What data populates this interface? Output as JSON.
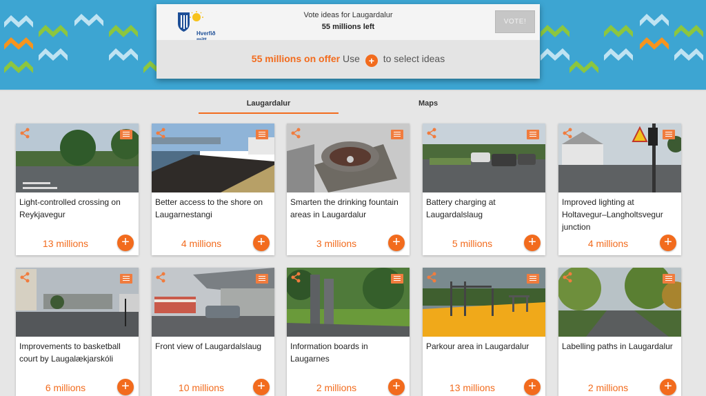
{
  "header": {
    "logo_text": "Hverfið mitt",
    "vote_title": "Vote ideas for Laugardalur",
    "millions_left": "55 millions left",
    "vote_button": "VOTE!",
    "offer_highlight": "55 millions on offer",
    "offer_use": "Use",
    "offer_plus": "+",
    "offer_select": "to select ideas"
  },
  "tabs": [
    {
      "label": "Laugardalur",
      "active": true
    },
    {
      "label": "Maps",
      "active": false
    }
  ],
  "icons": {
    "share": "share-icon",
    "menu": "menu-icon",
    "add": "plus-circle-icon"
  },
  "colors": {
    "accent": "#f26b1d",
    "banner": "#3da5d2"
  },
  "ideas": [
    {
      "title": "Light-controlled crossing on Reykjavegur",
      "price": "13 millions",
      "add": "+"
    },
    {
      "title": "Better access to the shore on Laugarnestangi",
      "price": "4 millions",
      "add": "+"
    },
    {
      "title": "Smarten the drinking fountain areas in Laugardalur",
      "price": "3 millions",
      "add": "+"
    },
    {
      "title": "Battery charging at Laugardalslaug",
      "price": "5 millions",
      "add": "+"
    },
    {
      "title": "Improved lighting at Holtavegur–Langholtsvegur junction",
      "price": "4 millions",
      "add": "+"
    },
    {
      "title": "Improvements to basketball court by Laugalækjarskóli",
      "price": "6 millions",
      "add": "+"
    },
    {
      "title": "Front view of Laugardalslaug",
      "price": "10 millions",
      "add": "+"
    },
    {
      "title": "Information boards in Laugarnes",
      "price": "2 millions",
      "add": "+"
    },
    {
      "title": "Parkour area in Laugardalur",
      "price": "13 millions",
      "add": "+"
    },
    {
      "title": "Labelling paths in Laugardalur",
      "price": "2 millions",
      "add": "+"
    }
  ]
}
